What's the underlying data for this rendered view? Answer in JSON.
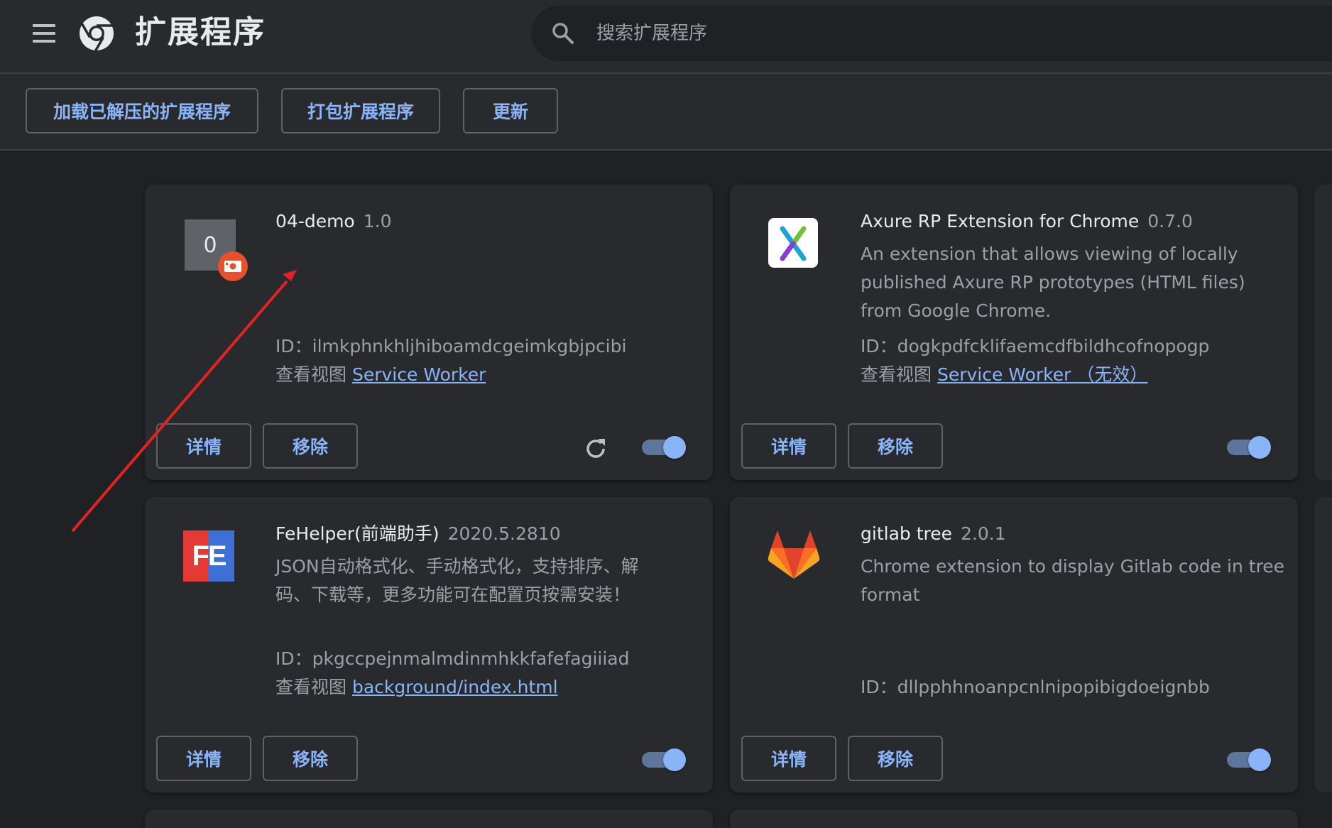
{
  "app": {
    "title": "扩展程序"
  },
  "search": {
    "placeholder": "搜索扩展程序"
  },
  "toolbar": {
    "load_unpacked_label": "加载已解压的扩展程序",
    "pack_label": "打包扩展程序",
    "update_label": "更新"
  },
  "colors": {
    "accent": "#8ab4f8",
    "background": "#202124",
    "surface": "#292a2d",
    "annotation": "#e32222"
  },
  "extensions": [
    {
      "name": "04-demo",
      "version": "1.0",
      "description": "",
      "icon": "letter-0-icon",
      "icon_letter": "0",
      "badge_icon": "unpacked-badge-icon",
      "id_text": "ID：ilmkphnkhljhiboamdcgeimkgbjpcibi",
      "views_label": "查看视图",
      "view_link": "Service Worker",
      "details_label": "详情",
      "remove_label": "移除",
      "has_reload": true,
      "enabled": true
    },
    {
      "name": "Axure RP Extension for Chrome",
      "version": "0.7.0",
      "description": "An extension that allows viewing of locally published Axure RP prototypes (HTML files) from Google Chrome.",
      "icon": "axure-icon",
      "id_text": "ID：dogkpdfcklifaemcdfbildhcofnopogp",
      "views_label": "查看视图",
      "view_link": "Service Worker （无效）",
      "details_label": "详情",
      "remove_label": "移除",
      "has_reload": false,
      "enabled": true
    },
    {
      "name": "FeHelper(前端助手)",
      "version": "2020.5.2810",
      "description": "JSON自动格式化、手动格式化，支持排序、解码、下载等，更多功能可在配置页按需安装！",
      "icon": "fehelper-icon",
      "icon_letters": "FE",
      "id_text": "ID：pkgccpejnmalmdinmhkkfafefagiiiad",
      "views_label": "查看视图",
      "view_link": "background/index.html",
      "details_label": "详情",
      "remove_label": "移除",
      "has_reload": false,
      "enabled": true
    },
    {
      "name": "gitlab tree",
      "version": "2.0.1",
      "description": "Chrome extension to display Gitlab code in tree format",
      "icon": "gitlab-icon",
      "id_text": "ID：dllpphhnoanpcnlnipopibigdoeignbb",
      "details_label": "详情",
      "remove_label": "移除",
      "has_reload": false,
      "enabled": true
    }
  ]
}
